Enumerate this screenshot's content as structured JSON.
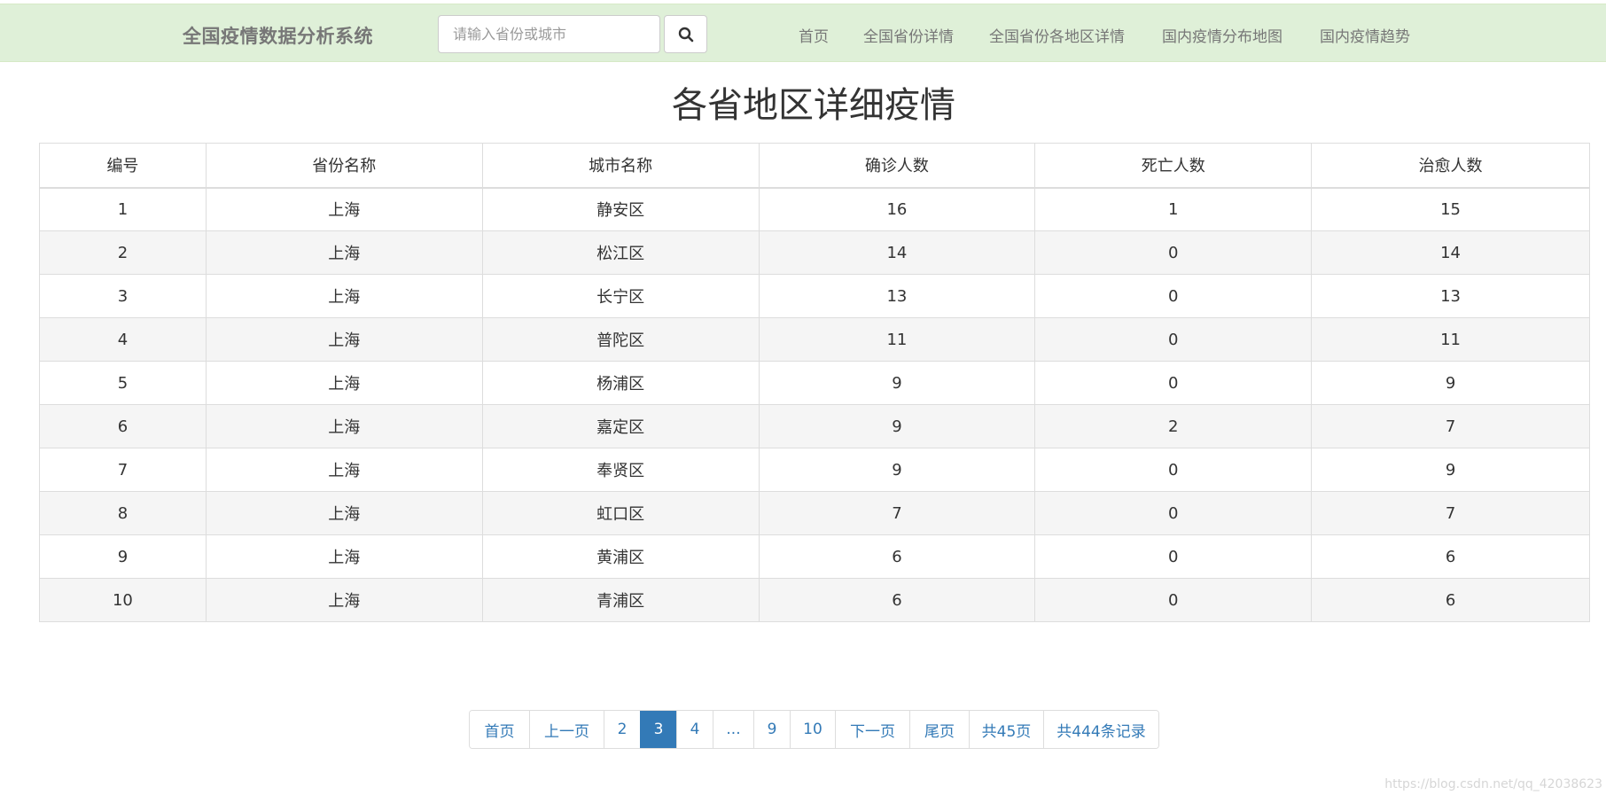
{
  "navbar": {
    "brand": "全国疫情数据分析系统",
    "search": {
      "placeholder": "请输入省份或城市",
      "value": ""
    },
    "search_button_icon": "search-icon",
    "links": [
      "首页",
      "全国省份详情",
      "全国省份各地区详情",
      "国内疫情分布地图",
      "国内疫情趋势"
    ]
  },
  "page_title": "各省地区详细疫情",
  "table": {
    "headers": [
      "编号",
      "省份名称",
      "城市名称",
      "确诊人数",
      "死亡人数",
      "治愈人数"
    ],
    "rows": [
      [
        "1",
        "上海",
        "静安区",
        "16",
        "1",
        "15"
      ],
      [
        "2",
        "上海",
        "松江区",
        "14",
        "0",
        "14"
      ],
      [
        "3",
        "上海",
        "长宁区",
        "13",
        "0",
        "13"
      ],
      [
        "4",
        "上海",
        "普陀区",
        "11",
        "0",
        "11"
      ],
      [
        "5",
        "上海",
        "杨浦区",
        "9",
        "0",
        "9"
      ],
      [
        "6",
        "上海",
        "嘉定区",
        "9",
        "2",
        "7"
      ],
      [
        "7",
        "上海",
        "奉贤区",
        "9",
        "0",
        "9"
      ],
      [
        "8",
        "上海",
        "虹口区",
        "7",
        "0",
        "7"
      ],
      [
        "9",
        "上海",
        "黄浦区",
        "6",
        "0",
        "6"
      ],
      [
        "10",
        "上海",
        "青浦区",
        "6",
        "0",
        "6"
      ]
    ]
  },
  "pagination": {
    "items": [
      "首页",
      "上一页",
      "2",
      "3",
      "4",
      "...",
      "9",
      "10",
      "下一页",
      "尾页",
      "共45页",
      "共444条记录"
    ],
    "active": "3"
  },
  "watermark": "https://blog.csdn.net/qq_42038623",
  "colors": {
    "navbar_bg": "#dff0d8",
    "link": "#337ab7",
    "active_page": "#337ab7",
    "stripe": "#f5f5f5"
  }
}
